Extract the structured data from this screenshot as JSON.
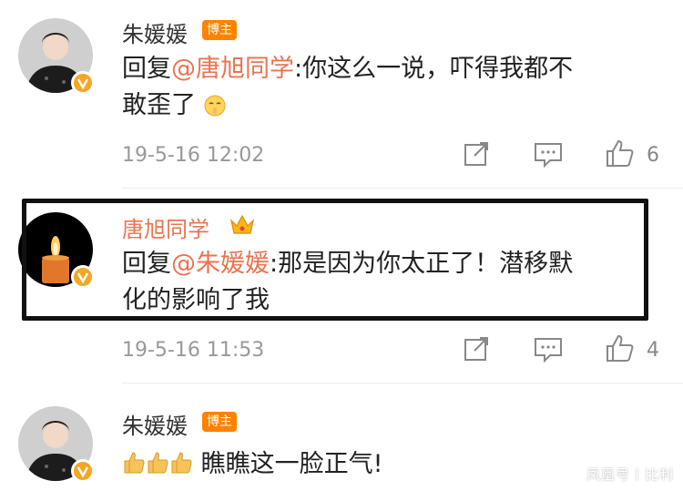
{
  "comments": [
    {
      "username": "朱媛媛",
      "badge": "博主",
      "reply_prefix": "回复",
      "mention": "@唐旭同学",
      "line1": ":你这么一说，吓得我都不",
      "line2": "敢歪了",
      "emoji": "shush-face",
      "timestamp": "19-5-16 12:02",
      "likes": "6"
    },
    {
      "username": "唐旭同学",
      "badge_icon": "crown-icon",
      "reply_prefix": "回复",
      "mention": "@朱媛媛",
      "line1": ":那是因为你太正了！潜移默",
      "line2": "化的影响了我",
      "timestamp": "19-5-16 11:53",
      "likes": "4"
    },
    {
      "username": "朱媛媛",
      "badge": "博主",
      "text": "瞧瞧这一脸正气!",
      "emoji": "thumbs-up-x3"
    }
  ],
  "watermark": "凤凰号丨比利",
  "colors": {
    "accent": "#eb7350",
    "badge": "#ff8200",
    "gray_text": "#999999"
  }
}
